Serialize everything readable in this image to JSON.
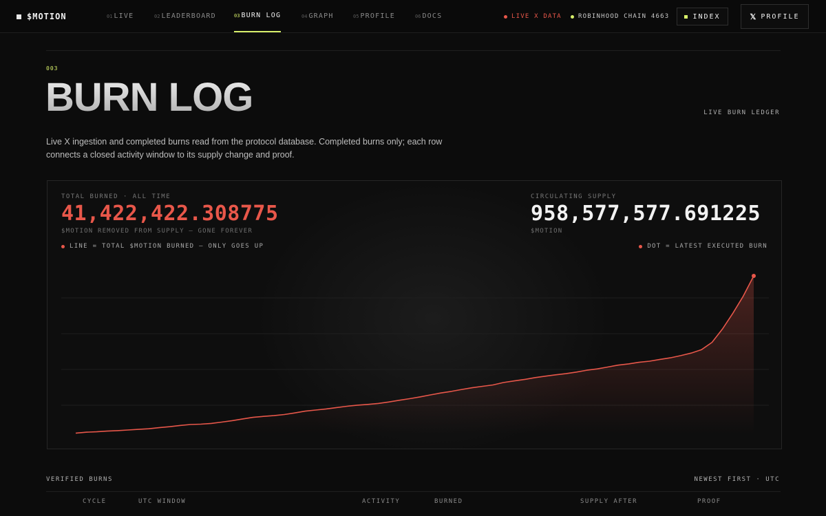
{
  "brand": {
    "name": "$MOTION"
  },
  "nav": {
    "items": [
      {
        "num": "01",
        "label": "LIVE"
      },
      {
        "num": "02",
        "label": "LEADERBOARD"
      },
      {
        "num": "03",
        "label": "BURN LOG"
      },
      {
        "num": "04",
        "label": "GRAPH"
      },
      {
        "num": "05",
        "label": "PROFILE"
      },
      {
        "num": "06",
        "label": "DOCS"
      }
    ],
    "active_index": 2
  },
  "status": {
    "live": "LIVE X DATA",
    "chain": "ROBINHOOD CHAIN 4663",
    "live_color": "#e8574a",
    "chain_color": "#d8f06a"
  },
  "buttons": {
    "index": "INDEX",
    "profile": "PROFILE"
  },
  "hero": {
    "section_num": "003",
    "title": "BURN LOG",
    "side_label": "LIVE BURN LEDGER",
    "description": "Live X ingestion and completed burns read from the protocol database. Completed burns only; each row connects a closed activity window to its supply change and proof."
  },
  "stats": {
    "total_label": "TOTAL BURNED · ALL TIME",
    "total_value": "41,422,422.308775",
    "total_sub": "$MOTION REMOVED FROM SUPPLY — GONE FOREVER",
    "supply_label": "CIRCULATING SUPPLY",
    "supply_value": "958,577,577.691225",
    "supply_sub": "$MOTION",
    "legend_line": "LINE = TOTAL $MOTION BURNED — ONLY GOES UP",
    "legend_dot": "DOT = LATEST EXECUTED BURN"
  },
  "colors": {
    "accent": "#e8574a",
    "highlight": "#d8f06a"
  },
  "chart_data": {
    "type": "area",
    "grid": true,
    "legend": "top-left",
    "series": [
      {
        "values": [
          0.6,
          1.2,
          1.5,
          1.9,
          2.2,
          2.6,
          3.0,
          3.4,
          4.1,
          4.7,
          5.5,
          6.1,
          6.3,
          6.8,
          7.6,
          8.5,
          9.6,
          10.6,
          11.2,
          11.7,
          12.4,
          13.4,
          14.5,
          15.2,
          15.9,
          16.8,
          17.6,
          18.3,
          18.8,
          19.4,
          20.3,
          21.4,
          22.4,
          23.5,
          24.8,
          26.0,
          27.0,
          28.2,
          29.3,
          30.2,
          31.1,
          32.6,
          33.6,
          34.5,
          35.7,
          36.6,
          37.5,
          38.2,
          39.2,
          40.4,
          41.2,
          42.4,
          43.6,
          44.4,
          45.4,
          46.1,
          47.2,
          48.2,
          49.6,
          51.2,
          53.4,
          58.0,
          66.4,
          76.4,
          87.2,
          100.0
        ]
      }
    ],
    "latest_point": {
      "value": 100.0
    }
  },
  "table": {
    "title": "VERIFIED BURNS",
    "sort": "NEWEST FIRST · UTC",
    "columns": [
      "CYCLE",
      "UTC WINDOW",
      "ACTIVITY",
      "BURNED",
      "SUPPLY AFTER",
      "PROOF"
    ]
  }
}
